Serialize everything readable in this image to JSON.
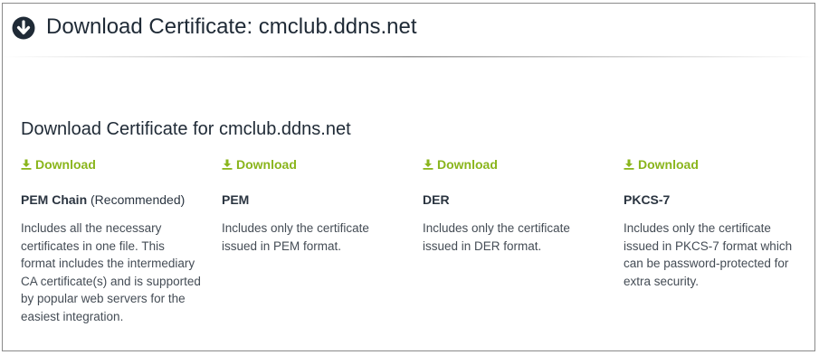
{
  "header": {
    "icon": "download-circle-icon",
    "title": "Download Certificate: cmclub.ddns.net"
  },
  "section": {
    "title": "Download Certificate for cmclub.ddns.net"
  },
  "colors": {
    "link": "#8ab51c",
    "title": "#1f2a36",
    "body": "#444c55",
    "border": "#8a8a8a"
  },
  "formats": [
    {
      "download_label": "Download",
      "name": "PEM Chain",
      "note": " (Recommended)",
      "description": "Includes all the necessary certificates in one file. This format includes the intermediary CA certificate(s) and is supported by popular web servers for the easiest integration."
    },
    {
      "download_label": "Download",
      "name": "PEM",
      "note": "",
      "description": "Includes only the certificate issued in PEM format."
    },
    {
      "download_label": "Download",
      "name": "DER",
      "note": "",
      "description": "Includes only the certificate issued in DER format."
    },
    {
      "download_label": "Download",
      "name": "PKCS-7",
      "note": "",
      "description": "Includes only the certificate issued in PKCS-7 format which can be password-protected for extra security."
    }
  ]
}
